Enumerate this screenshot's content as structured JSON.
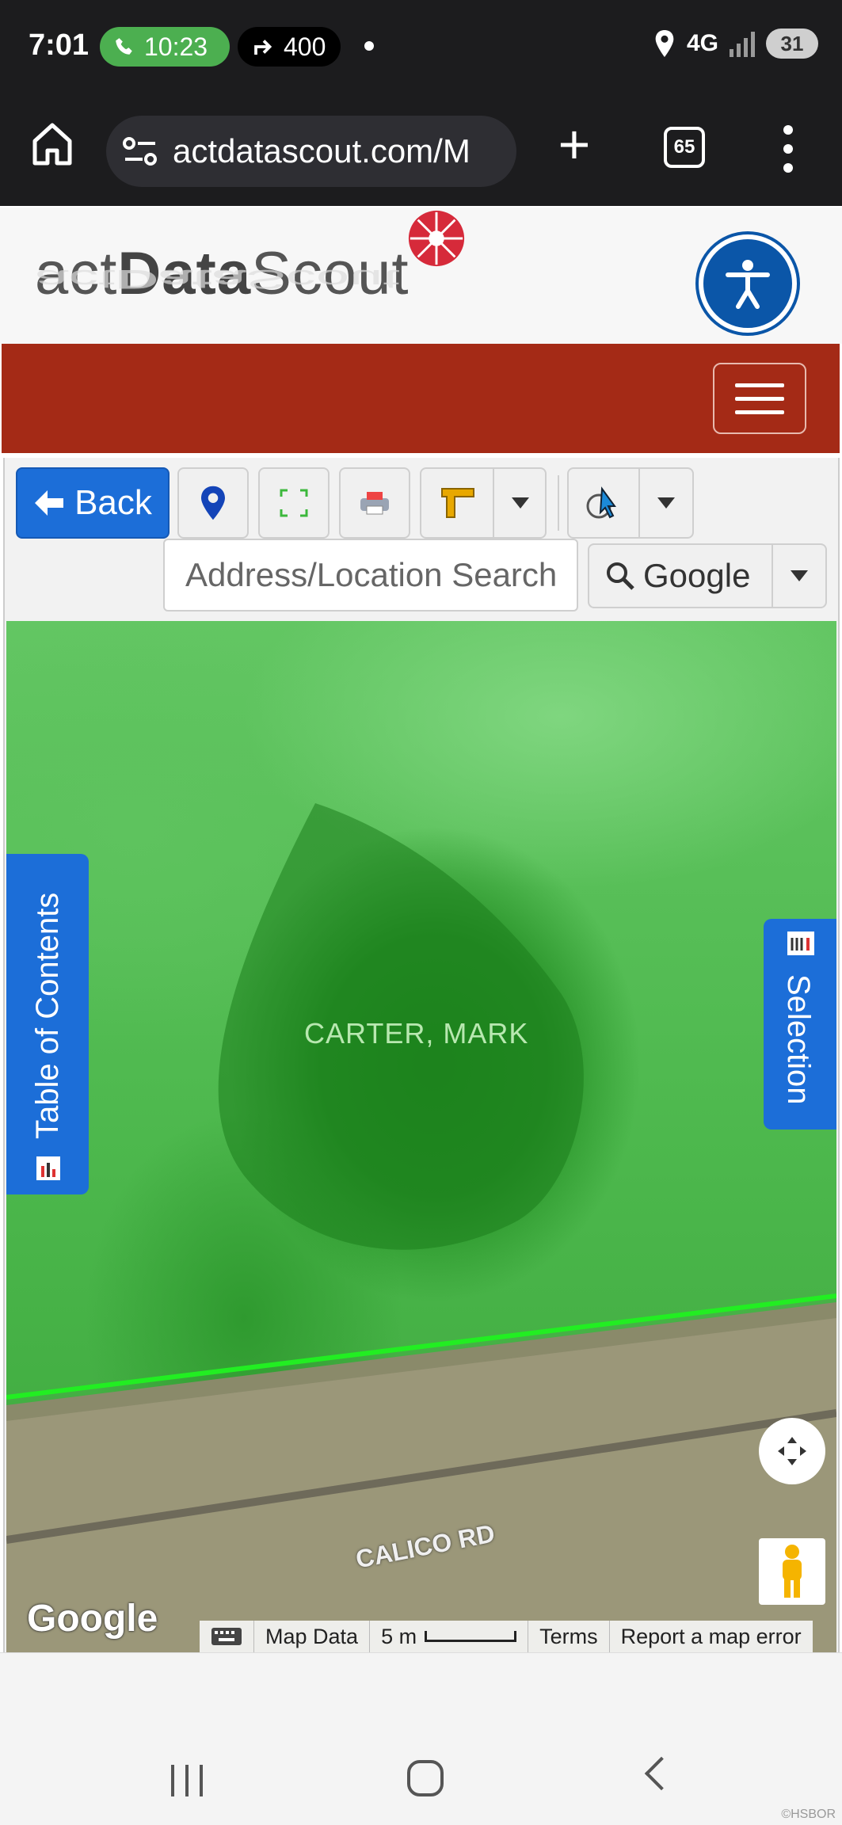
{
  "status_bar": {
    "time": "7:01",
    "call_timer": "10:23",
    "forward_text": "400",
    "network": "4G",
    "battery": "31"
  },
  "browser": {
    "url": "actdatascout.com/M",
    "tab_count": "65"
  },
  "site": {
    "logo_prefix": "act",
    "logo_bold": "Data",
    "logo_suffix": "Scout"
  },
  "toolbar": {
    "back_label": "Back",
    "search_placeholder": "Address/Location Search",
    "search_provider": "Google"
  },
  "map": {
    "owner_label": "CARTER, MARK",
    "road_label": "CALICO RD",
    "toc_label": "Table of Contents",
    "selection_label": "Selection",
    "google_logo": "Google",
    "attribution": {
      "map_data": "Map Data",
      "scale": "5 m",
      "terms": "Terms",
      "report": "Report a map error"
    }
  },
  "watermark": "©HSBOR"
}
